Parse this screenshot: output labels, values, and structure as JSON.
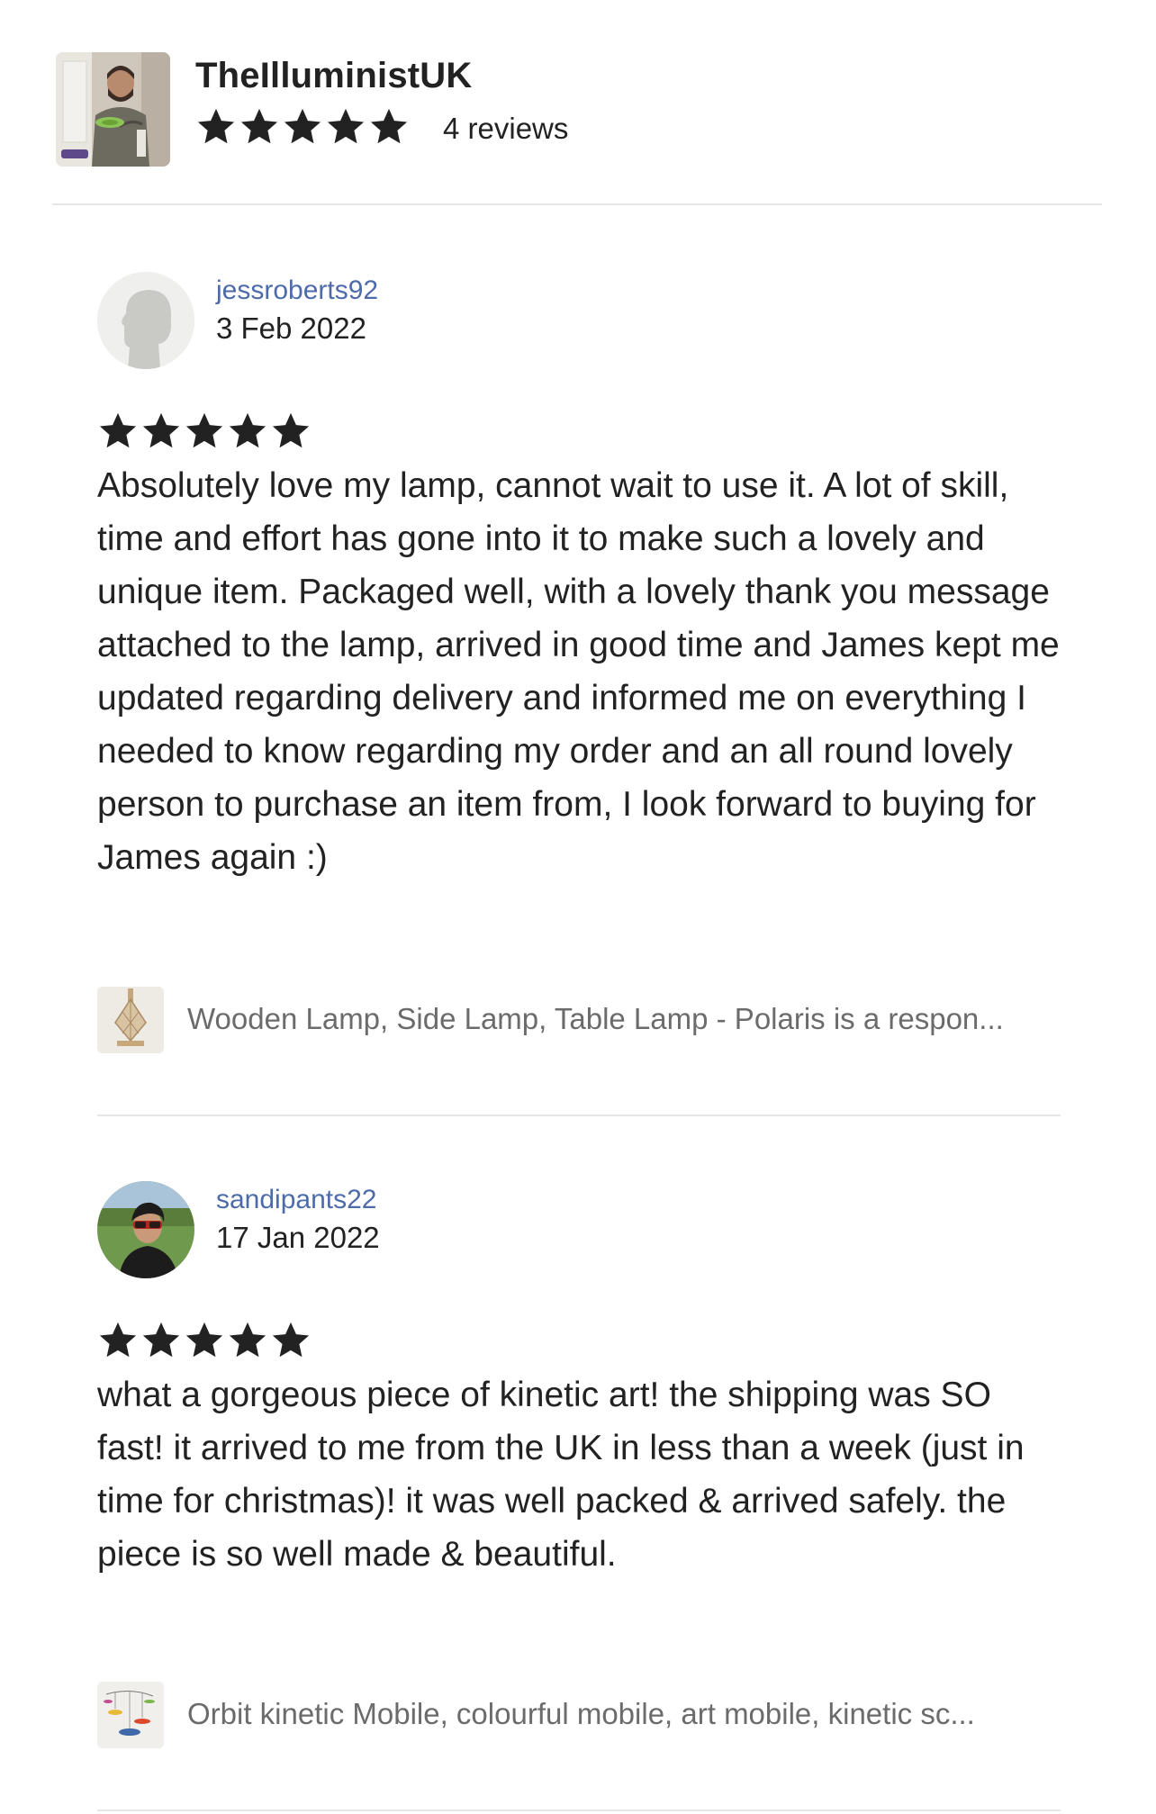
{
  "shop": {
    "name": "TheIlluministUK",
    "rating": 5,
    "review_count": "4 reviews"
  },
  "reviews": [
    {
      "reviewer": "jessroberts92",
      "date": "3 Feb 2022",
      "rating": 5,
      "text": "Absolutely love my lamp, cannot wait to use it. A lot of skill, time and effort has gone into it to make such a lovely and unique item. Packaged well, with a lovely thank you message attached to the lamp, arrived in good time and James kept me updated regarding delivery and informed me on everything I needed to know regarding my order and an all round lovely person to purchase an item from, I look forward to buying for James again :)",
      "item": "Wooden Lamp, Side Lamp, Table Lamp - Polaris is a respon..."
    },
    {
      "reviewer": "sandipants22",
      "date": "17 Jan 2022",
      "rating": 5,
      "text": "what a gorgeous piece of kinetic art!  the shipping was SO fast!  it arrived to me from the UK in less than a week (just in time for christmas)!  it was well packed & arrived safely. the piece is so well made & beautiful.",
      "item": "Orbit kinetic Mobile, colourful mobile, art mobile, kinetic sc..."
    }
  ],
  "colors": {
    "reviewer_name": "#4d6bab",
    "star": "#222222",
    "divider": "#e6e6e6",
    "muted_text": "#6b6b6b"
  }
}
